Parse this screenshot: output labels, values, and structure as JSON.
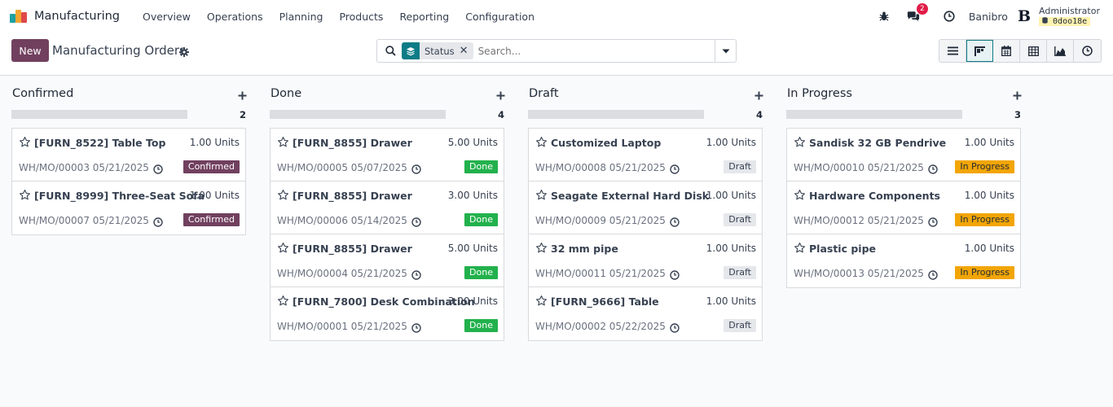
{
  "navbar": {
    "app_name": "Manufacturing",
    "menus": [
      "Overview",
      "Operations",
      "Planning",
      "Products",
      "Reporting",
      "Configuration"
    ],
    "chat_badge": "2",
    "company": "Banibro",
    "user_initial": "B",
    "user_name": "Administrator",
    "db_name": "0doo18e"
  },
  "control": {
    "new_label": "New",
    "title": "Manufacturing Orders",
    "facet_label": "Status",
    "facet_remove": "✕",
    "search_placeholder": "Search..."
  },
  "colors": {
    "brand": "#71405f",
    "teal": "#0e7c86",
    "confirmed": "#71405f",
    "done": "#22b14c",
    "draft": "#e5e7eb",
    "in_progress": "#f2a505"
  },
  "columns": [
    {
      "title": "Confirmed",
      "count": "2",
      "cards": [
        {
          "name": "[FURN_8522] Table Top",
          "qty": "1.00 Units",
          "ref": "WH/MO/00003 05/21/2025",
          "status": "Confirmed",
          "status_key": "confirmed"
        },
        {
          "name": "[FURN_8999] Three-Seat Sofa",
          "qty": "1.00 Units",
          "ref": "WH/MO/00007 05/21/2025",
          "status": "Confirmed",
          "status_key": "confirmed"
        }
      ]
    },
    {
      "title": "Done",
      "count": "4",
      "cards": [
        {
          "name": "[FURN_8855] Drawer",
          "qty": "5.00 Units",
          "ref": "WH/MO/00005 05/07/2025",
          "status": "Done",
          "status_key": "done"
        },
        {
          "name": "[FURN_8855] Drawer",
          "qty": "3.00 Units",
          "ref": "WH/MO/00006 05/14/2025",
          "status": "Done",
          "status_key": "done"
        },
        {
          "name": "[FURN_8855] Drawer",
          "qty": "5.00 Units",
          "ref": "WH/MO/00004 05/21/2025",
          "status": "Done",
          "status_key": "done"
        },
        {
          "name": "[FURN_7800] Desk Combination",
          "qty": "3.00 Units",
          "ref": "WH/MO/00001 05/21/2025",
          "status": "Done",
          "status_key": "done"
        }
      ]
    },
    {
      "title": "Draft",
      "count": "4",
      "cards": [
        {
          "name": "Customized Laptop",
          "qty": "1.00 Units",
          "ref": "WH/MO/00008 05/21/2025",
          "status": "Draft",
          "status_key": "draft"
        },
        {
          "name": "Seagate External Hard Disk",
          "qty": "1.00 Units",
          "ref": "WH/MO/00009 05/21/2025",
          "status": "Draft",
          "status_key": "draft"
        },
        {
          "name": "32 mm pipe",
          "qty": "1.00 Units",
          "ref": "WH/MO/00011 05/21/2025",
          "status": "Draft",
          "status_key": "draft"
        },
        {
          "name": "[FURN_9666] Table",
          "qty": "1.00 Units",
          "ref": "WH/MO/00002 05/22/2025",
          "status": "Draft",
          "status_key": "draft"
        }
      ]
    },
    {
      "title": "In Progress",
      "count": "3",
      "cards": [
        {
          "name": "Sandisk 32 GB Pendrive",
          "qty": "1.00 Units",
          "ref": "WH/MO/00010 05/21/2025",
          "status": "In Progress",
          "status_key": "in_progress"
        },
        {
          "name": "Hardware Components",
          "qty": "1.00 Units",
          "ref": "WH/MO/00012 05/21/2025",
          "status": "In Progress",
          "status_key": "in_progress"
        },
        {
          "name": "Plastic pipe",
          "qty": "1.00 Units",
          "ref": "WH/MO/00013 05/21/2025",
          "status": "In Progress",
          "status_key": "in_progress"
        }
      ]
    }
  ]
}
